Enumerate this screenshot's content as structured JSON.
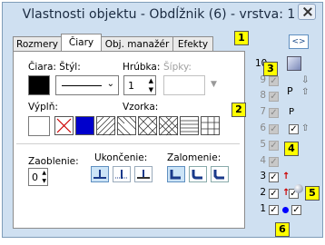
{
  "window": {
    "title": "Vlastnosti objektu - Obdĺžnik (6) - vrstva: 1"
  },
  "tabs": [
    {
      "label": "Rozmery"
    },
    {
      "label": "Čiary"
    },
    {
      "label": "Obj. manažér"
    },
    {
      "label": "Efekty"
    }
  ],
  "nav_button": {
    "label": "<>"
  },
  "line": {
    "label_color_style": "Čiara: Štýl:",
    "label_width": "Hrúbka:",
    "width_value": "1",
    "label_arrows": "Šípky:",
    "line_color": "#000000"
  },
  "fill": {
    "label": "Výplň:",
    "label_pattern": "Vzorka:",
    "colors": {
      "selected": "#0000cc"
    }
  },
  "rounding": {
    "label": "Zaoblenie:",
    "value": "0"
  },
  "caps": {
    "label": "Ukončenie:"
  },
  "joins": {
    "label": "Zalomenie:"
  },
  "layers": {
    "rows": [
      {
        "num": "10"
      },
      {
        "num": "9"
      },
      {
        "num": "8"
      },
      {
        "num": "7"
      },
      {
        "num": "6"
      },
      {
        "num": "5"
      },
      {
        "num": "4"
      },
      {
        "num": "3"
      },
      {
        "num": "2"
      },
      {
        "num": "1"
      }
    ],
    "p_label_1": "P",
    "p_label_2": "P"
  },
  "badges": [
    "1",
    "2",
    "3",
    "4",
    "5",
    "6"
  ],
  "accent": {
    "up_arrow": "#cc0000",
    "dot": "#0000ff",
    "badge": "#ffff00"
  }
}
